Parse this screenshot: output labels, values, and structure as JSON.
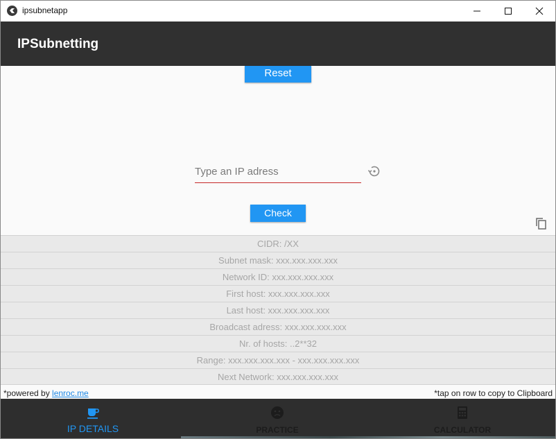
{
  "window": {
    "title": "ipsubnetapp"
  },
  "appbar": {
    "title": "IPSubnetting"
  },
  "controls": {
    "reset_label": "Reset",
    "ip_placeholder": "Type an IP adress",
    "check_label": "Check"
  },
  "results": [
    {
      "text": "CIDR: /XX"
    },
    {
      "text": "Subnet mask: xxx.xxx.xxx.xxx"
    },
    {
      "text": "Network ID: xxx.xxx.xxx.xxx"
    },
    {
      "text": "First host: xxx.xxx.xxx.xxx"
    },
    {
      "text": "Last host: xxx.xxx.xxx.xxx"
    },
    {
      "text": "Broadcast adress: xxx.xxx.xxx.xxx"
    },
    {
      "text": "Nr. of hosts: ..2**32"
    },
    {
      "text": "Range: xxx.xxx.xxx.xxx - xxx.xxx.xxx.xxx"
    },
    {
      "text": "Next Network: xxx.xxx.xxx.xxx"
    }
  ],
  "footer": {
    "powered_prefix": "*powered by ",
    "powered_link": "lenroc.me",
    "tap_hint": "*tap on row to copy to Clipboard"
  },
  "nav": {
    "items": [
      {
        "label": "IP DETAILS",
        "icon": "coffee-cup-icon",
        "active": true
      },
      {
        "label": "PRACTICE",
        "icon": "sad-face-icon",
        "active": false
      },
      {
        "label": "CALCULATOR",
        "icon": "calculator-icon",
        "active": false
      }
    ]
  },
  "colors": {
    "accent": "#2196f3",
    "appbar": "#303030",
    "input_underline": "#c62828",
    "row_background": "#e9e9e9"
  }
}
